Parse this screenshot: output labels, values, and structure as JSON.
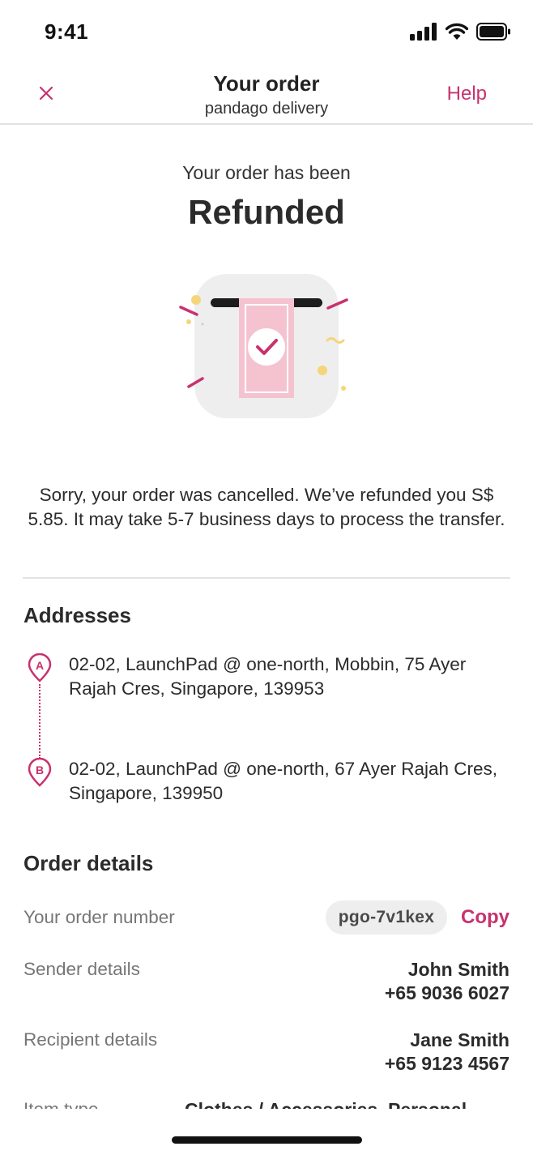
{
  "status_bar": {
    "time": "9:41"
  },
  "nav": {
    "title": "Your order",
    "subtitle": "pandago delivery",
    "help_label": "Help"
  },
  "status": {
    "intro": "Your order has been",
    "state": "Refunded"
  },
  "message": "Sorry, your order was cancelled. We’ve refunded you S$ 5.85. It may take 5-7 business days to process the transfer.",
  "addresses": {
    "title": "Addresses",
    "items": [
      {
        "marker": "A",
        "text": "02-02, LaunchPad @ one-north, Mobbin, 75 Ayer Rajah Cres, Singapore, 139953"
      },
      {
        "marker": "B",
        "text": "02-02, LaunchPad @ one-north, 67 Ayer Rajah Cres, Singapore, 139950"
      }
    ]
  },
  "order_details": {
    "title": "Order details",
    "order_number_label": "Your order number",
    "order_number": "pgo-7v1kex",
    "copy_label": "Copy",
    "sender_label": "Sender details",
    "sender_name": "John Smith",
    "sender_phone": "+65 9036 6027",
    "recipient_label": "Recipient details",
    "recipient_name": "Jane Smith",
    "recipient_phone": "+65 9123 4567",
    "cut_label": "Item type",
    "cut_value": "Clothes / Accessories, Personal"
  },
  "colors": {
    "accent": "#c8326e",
    "pink_light": "#f4c3cf",
    "yellow": "#f5d57a",
    "grey_bg": "#eeeeee"
  }
}
